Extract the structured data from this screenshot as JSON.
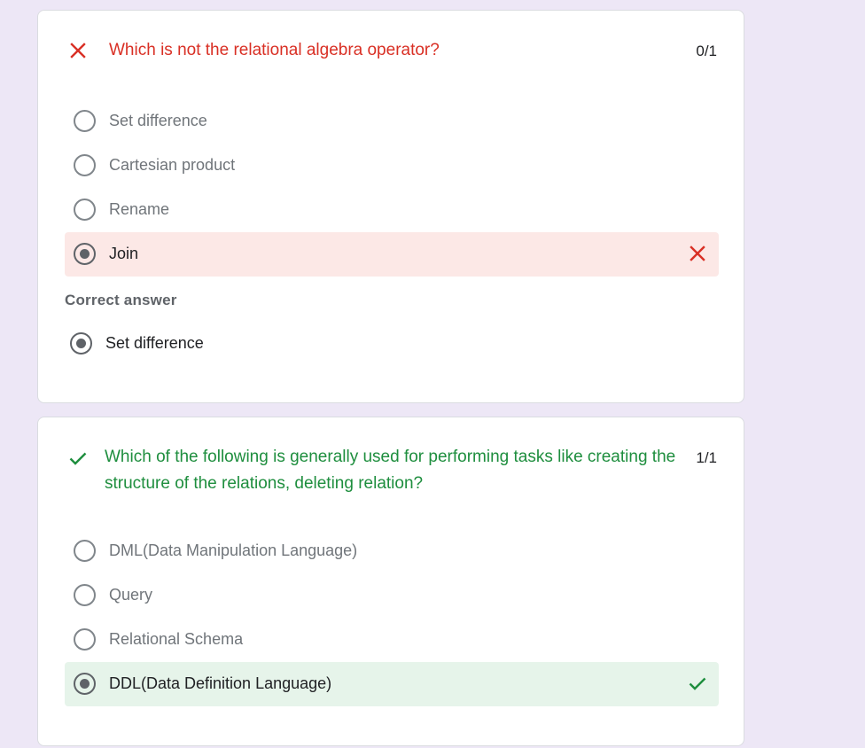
{
  "questions": [
    {
      "status": "incorrect",
      "status_icon": "close-icon",
      "text": "Which is not the relational algebra operator?",
      "score": "0/1",
      "options": [
        {
          "label": "Set difference",
          "selected": false
        },
        {
          "label": "Cartesian product",
          "selected": false
        },
        {
          "label": "Rename",
          "selected": false
        },
        {
          "label": "Join",
          "selected": true,
          "result": "incorrect",
          "result_icon": "close-icon"
        }
      ],
      "correct_answer_heading": "Correct answer",
      "correct_answer": "Set difference"
    },
    {
      "status": "correct",
      "status_icon": "check-icon",
      "text": "Which of the following is generally used for performing tasks like creating the structure of the relations, deleting relation?",
      "score": "1/1",
      "options": [
        {
          "label": "DML(Data Manipulation Language)",
          "selected": false
        },
        {
          "label": "Query",
          "selected": false
        },
        {
          "label": "Relational Schema",
          "selected": false
        },
        {
          "label": "DDL(Data Definition Language)",
          "selected": true,
          "result": "correct",
          "result_icon": "check-icon"
        }
      ]
    }
  ],
  "colors": {
    "background": "#ede7f6",
    "incorrect": "#d93025",
    "correct": "#1e8e3e",
    "incorrect_bg": "#fce8e6",
    "correct_bg": "#e6f4ea"
  }
}
